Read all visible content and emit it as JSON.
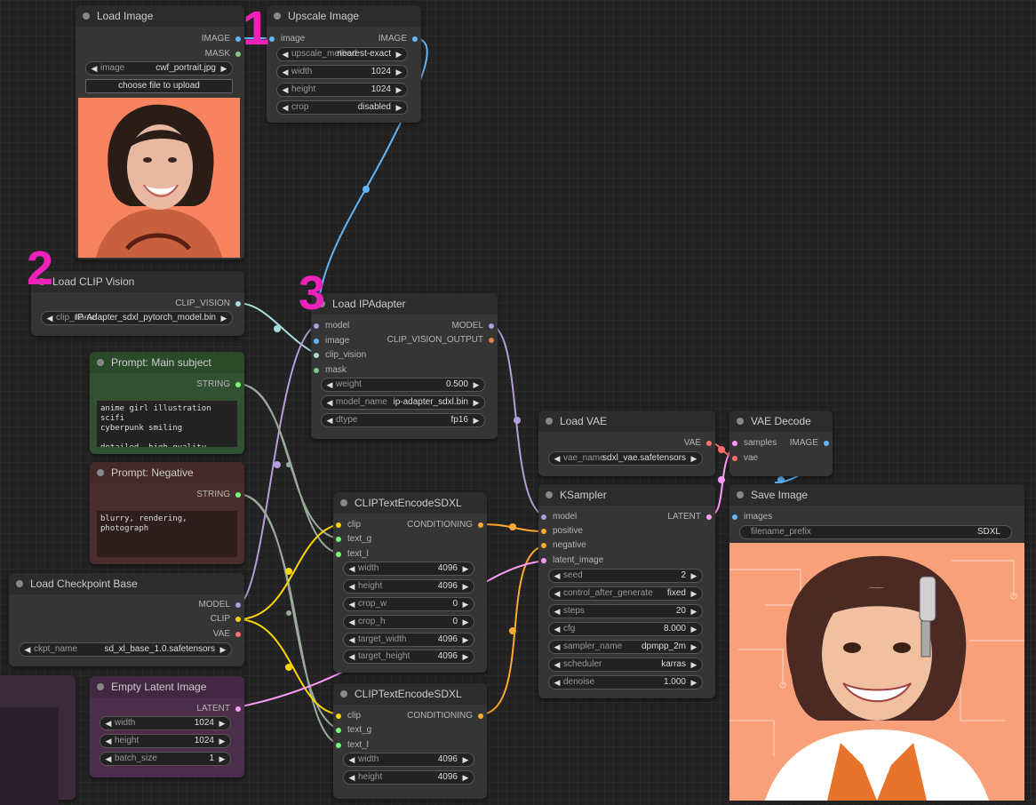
{
  "markers": {
    "m1": "1",
    "m2": "2",
    "m3": "3"
  },
  "colors": {
    "image": "#64b5f6",
    "mask": "#81c784",
    "clip_vision": "#a8dadc",
    "model": "#b39ddb",
    "clip": "#ffd500",
    "vae": "#ff6e6e",
    "conditioning": "#ffa931",
    "latent": "#ff9cf9",
    "string": "#77ff77"
  },
  "load_image": {
    "title": "Load Image",
    "out_image": "IMAGE",
    "out_mask": "MASK",
    "image_label": "image",
    "image_value": "cwf_portrait.jpg",
    "upload_label": "choose file to upload"
  },
  "upscale": {
    "title": "Upscale Image",
    "in_image": "image",
    "out_image": "IMAGE",
    "method_label": "upscale_method",
    "method_value": "nearest-exact",
    "width_label": "width",
    "width_value": "1024",
    "height_label": "height",
    "height_value": "1024",
    "crop_label": "crop",
    "crop_value": "disabled"
  },
  "clip_vision": {
    "title": "Load CLIP Vision",
    "out": "CLIP_VISION",
    "name_label": "clip_name",
    "name_value": "IP-Adapter_sdxl_pytorch_model.bin"
  },
  "prompt_main": {
    "title": "Prompt: Main subject",
    "out": "STRING",
    "text": "anime girl illustration scifi\ncyberpunk smiling\n\ndetailed, high quality"
  },
  "prompt_neg": {
    "title": "Prompt: Negative",
    "out": "STRING",
    "text": "blurry, rendering, photograph"
  },
  "checkpoint": {
    "title": "Load Checkpoint Base",
    "out_model": "MODEL",
    "out_clip": "CLIP",
    "out_vae": "VAE",
    "ckpt_label": "ckpt_name",
    "ckpt_value": "sd_xl_base_1.0.safetensors"
  },
  "empty_latent": {
    "title": "Empty Latent Image",
    "out": "LATENT",
    "width_label": "width",
    "width_value": "1024",
    "height_label": "height",
    "height_value": "1024",
    "batch_label": "batch_size",
    "batch_value": "1"
  },
  "ipadapter": {
    "title": "Load IPAdapter",
    "in_model": "model",
    "in_image": "image",
    "in_clip_vision": "clip_vision",
    "in_mask": "mask",
    "out_model": "MODEL",
    "out_cvo": "CLIP_VISION_OUTPUT",
    "weight_label": "weight",
    "weight_value": "0.500",
    "model_name_label": "model_name",
    "model_name_value": "ip-adapter_sdxl.bin",
    "dtype_label": "dtype",
    "dtype_value": "fp16"
  },
  "clip_enc1": {
    "title": "CLIPTextEncodeSDXL",
    "in_clip": "clip",
    "in_text_g": "text_g",
    "in_text_l": "text_l",
    "out": "CONDITIONING",
    "widgets": [
      {
        "label": "width",
        "value": "4096"
      },
      {
        "label": "height",
        "value": "4096"
      },
      {
        "label": "crop_w",
        "value": "0"
      },
      {
        "label": "crop_h",
        "value": "0"
      },
      {
        "label": "target_width",
        "value": "4096"
      },
      {
        "label": "target_height",
        "value": "4096"
      }
    ]
  },
  "clip_enc2": {
    "title": "CLIPTextEncodeSDXL",
    "in_clip": "clip",
    "in_text_g": "text_g",
    "in_text_l": "text_l",
    "out": "CONDITIONING",
    "widgets": [
      {
        "label": "width",
        "value": "4096"
      },
      {
        "label": "height",
        "value": "4096"
      }
    ]
  },
  "load_vae": {
    "title": "Load VAE",
    "out": "VAE",
    "name_label": "vae_name",
    "name_value": "sdxl_vae.safetensors"
  },
  "vae_decode": {
    "title": "VAE Decode",
    "in_samples": "samples",
    "in_vae": "vae",
    "out": "IMAGE"
  },
  "ksampler": {
    "title": "KSampler",
    "in_model": "model",
    "in_positive": "positive",
    "in_negative": "negative",
    "in_latent": "latent_image",
    "out": "LATENT",
    "widgets": [
      {
        "label": "seed",
        "value": "2"
      },
      {
        "label": "control_after_generate",
        "value": "fixed"
      },
      {
        "label": "steps",
        "value": "20"
      },
      {
        "label": "cfg",
        "value": "8.000"
      },
      {
        "label": "sampler_name",
        "value": "dpmpp_2m"
      },
      {
        "label": "scheduler",
        "value": "karras"
      },
      {
        "label": "denoise",
        "value": "1.000"
      }
    ]
  },
  "save_image": {
    "title": "Save Image",
    "in_images": "images",
    "prefix_label": "filename_prefix",
    "prefix_value": "SDXL"
  }
}
